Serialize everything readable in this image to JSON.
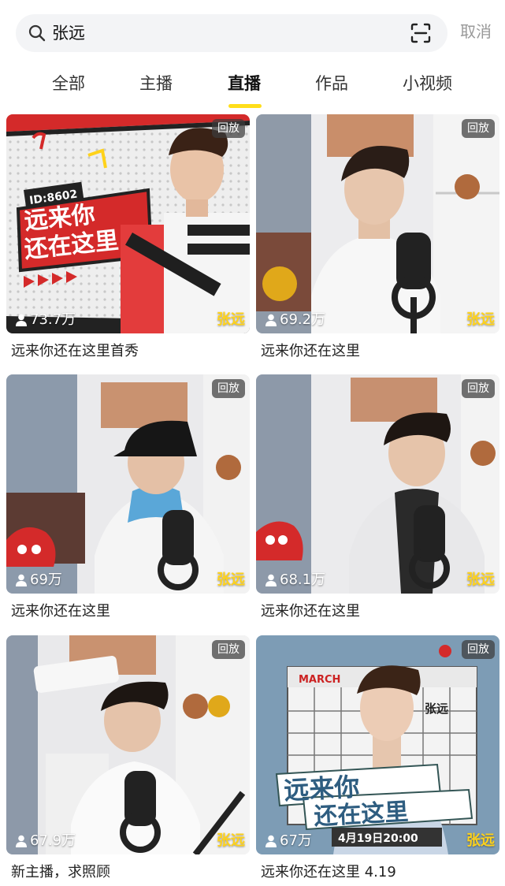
{
  "search": {
    "query": "张远",
    "cancel_label": "取消"
  },
  "tabs": [
    {
      "label": "全部"
    },
    {
      "label": "主播"
    },
    {
      "label": "直播"
    },
    {
      "label": "作品"
    },
    {
      "label": "小视频"
    }
  ],
  "active_tab": "直播",
  "accent_color": "#ffde1a",
  "cards": [
    {
      "badge": "回放",
      "views": "73.7万",
      "streamer": "张远",
      "title": "远来你还在这里首秀",
      "poster_id": "ID:8602",
      "poster_line1": "远来你",
      "poster_line2": "还在这里"
    },
    {
      "badge": "回放",
      "views": "69.2万",
      "streamer": "张远",
      "title": "远来你还在这里"
    },
    {
      "badge": "回放",
      "views": "69万",
      "streamer": "张远",
      "title": "远来你还在这里"
    },
    {
      "badge": "回放",
      "views": "68.1万",
      "streamer": "张远",
      "title": "远来你还在这里"
    },
    {
      "badge": "回放",
      "views": "67.9万",
      "streamer": "张远",
      "title": "新主播，求照顾"
    },
    {
      "badge": "回放",
      "views": "67万",
      "streamer": "张远",
      "title": "远来你还在这里 4.19",
      "poster_month": "MARCH",
      "poster_line1": "远来你",
      "poster_line2": "还在这里",
      "poster_date": "4月19日20:00",
      "poster_name": "张远"
    }
  ]
}
